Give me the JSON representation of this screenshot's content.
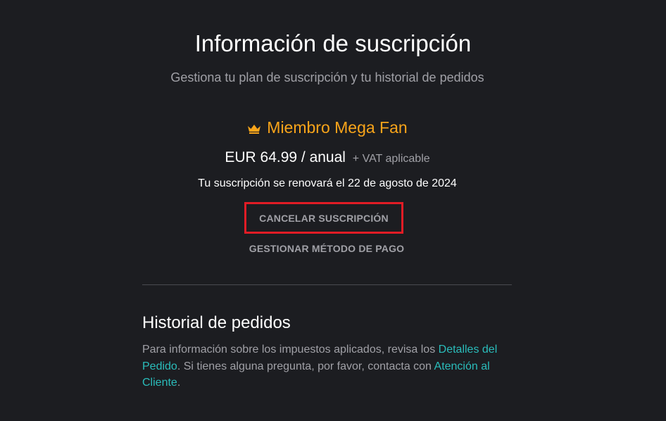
{
  "header": {
    "title": "Información de suscripción",
    "subtitle": "Gestiona tu plan de suscripción y tu historial de pedidos"
  },
  "plan": {
    "icon": "crown-icon",
    "name": "Miembro Mega Fan",
    "price": "EUR 64.99 / anual",
    "vat_note": "+ VAT aplicable",
    "renewal_text": "Tu suscripción se renovará el 22 de agosto de 2024",
    "accent_color": "#f8a41a"
  },
  "actions": {
    "cancel_label": "CANCELAR SUSCRIPCIÓN",
    "manage_payment_label": "GESTIONAR MÉTODO DE PAGO",
    "highlight_color": "#e11c25"
  },
  "history": {
    "title": "Historial de pedidos",
    "text_before_link1": "Para información sobre los impuestos aplicados, revisa los ",
    "link1": "Detalles del Pedido",
    "text_between": ". Si tienes alguna pregunta, por favor, contacta con ",
    "link2": "Atención al Cliente",
    "text_after": ".",
    "link_color": "#2abdbb"
  }
}
